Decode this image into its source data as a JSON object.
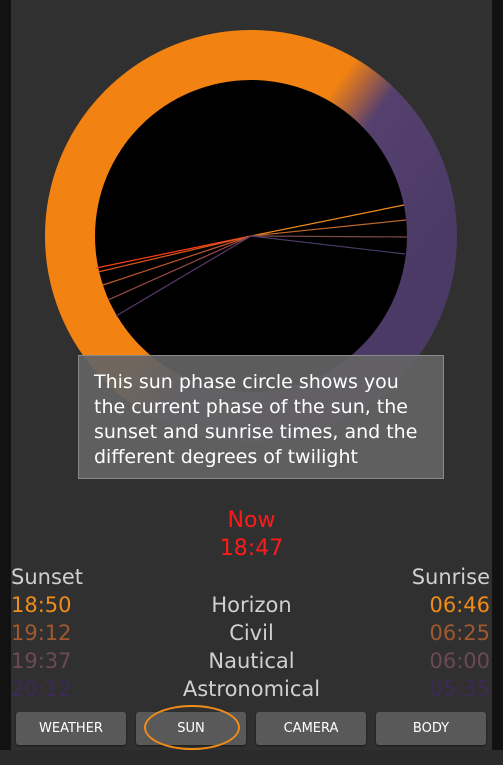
{
  "tooltip": {
    "text": "This sun phase circle shows you the current phase of the sun, the sunset and sunrise times, and the different degrees of twilight"
  },
  "now": {
    "label": "Now",
    "time": "18:47"
  },
  "columns": {
    "sunset": "Sunset",
    "sunrise": "Sunrise"
  },
  "phases": [
    {
      "name": "Horizon",
      "sunset": "18:50",
      "sunrise": "06:46",
      "color": "#f08c1a"
    },
    {
      "name": "Civil",
      "sunset": "19:12",
      "sunrise": "06:25",
      "color": "#a0582f"
    },
    {
      "name": "Nautical",
      "sunset": "19:37",
      "sunrise": "06:00",
      "color": "#6b4a55"
    },
    {
      "name": "Astronomical",
      "sunset": "20:12",
      "sunrise": "05:35",
      "color": "#3b2a55"
    }
  ],
  "nav": {
    "items": [
      "WEATHER",
      "SUN",
      "CAMERA",
      "BODY"
    ],
    "active": "SUN"
  },
  "colors": {
    "ring_day": "#f28211",
    "ring_night": "#4b3a66",
    "accent": "#f08c1a",
    "now_red": "#ff1a1a"
  }
}
